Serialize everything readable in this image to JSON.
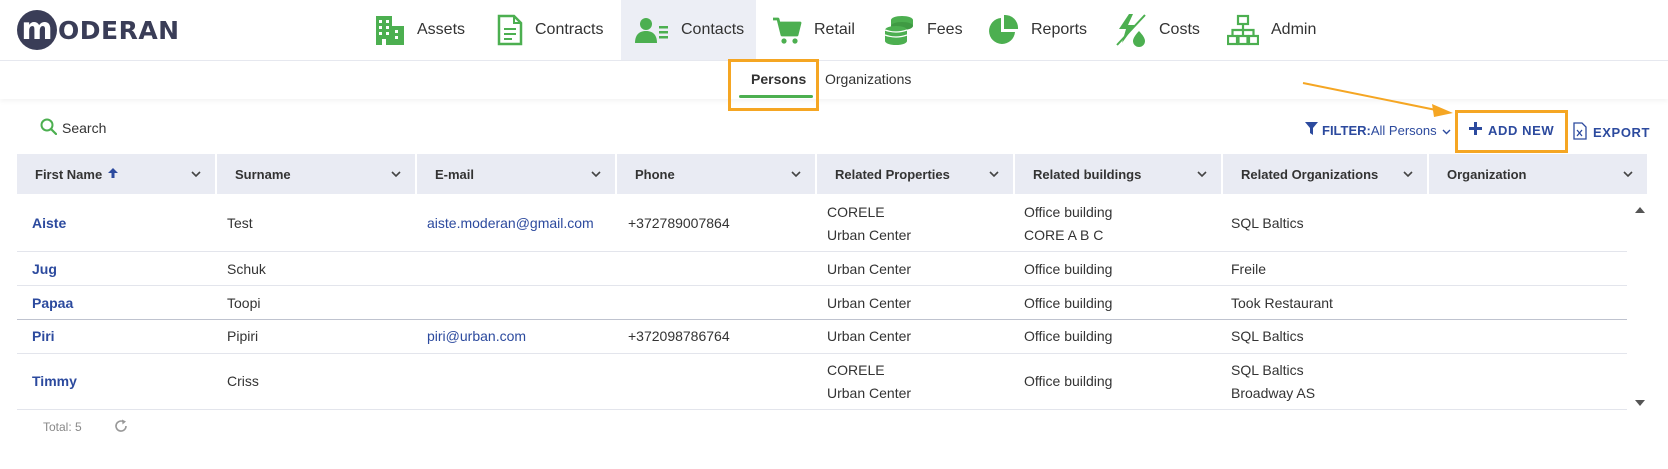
{
  "app": {
    "logo_letter": "m",
    "logo_text": "ODERAN"
  },
  "nav": [
    {
      "label": "Assets",
      "icon": "buildings-icon"
    },
    {
      "label": "Contracts",
      "icon": "document-icon"
    },
    {
      "label": "Contacts",
      "icon": "contacts-icon",
      "active": true
    },
    {
      "label": "Retail",
      "icon": "cart-icon"
    },
    {
      "label": "Fees",
      "icon": "coins-icon"
    },
    {
      "label": "Reports",
      "icon": "pie-chart-icon"
    },
    {
      "label": "Costs",
      "icon": "energy-icon"
    },
    {
      "label": "Admin",
      "icon": "org-chart-icon"
    }
  ],
  "subtabs": {
    "persons": "Persons",
    "organizations": "Organizations"
  },
  "toolbar": {
    "search": "Search",
    "filter_label": "FILTER:",
    "filter_value": "All Persons",
    "add_new": "ADD NEW",
    "export": "EXPORT"
  },
  "table": {
    "columns": [
      "First Name",
      "Surname",
      "E-mail",
      "Phone",
      "Related Properties",
      "Related buildings",
      "Related Organizations",
      "Organization"
    ],
    "sort_column": "First Name",
    "rows": [
      {
        "first": "Aiste",
        "surname": "Test",
        "email": "aiste.moderan@gmail.com",
        "phone": "+372789007864",
        "props1": "CORELE",
        "props2": "Urban Center",
        "bld1": "Office building",
        "bld2": "CORE A B C",
        "org1": "SQL Baltics",
        "org2": "",
        "organization": ""
      },
      {
        "first": "Jug",
        "surname": "Schuk",
        "email": "",
        "phone": "",
        "props1": "Urban Center",
        "props2": "",
        "bld1": "Office building",
        "bld2": "",
        "org1": "Freile",
        "org2": "",
        "organization": ""
      },
      {
        "first": "Papaa",
        "surname": "Toopi",
        "email": "",
        "phone": "",
        "props1": "Urban Center",
        "props2": "",
        "bld1": "Office building",
        "bld2": "",
        "org1": "Took Restaurant",
        "org2": "",
        "organization": ""
      },
      {
        "first": "Piri",
        "surname": "Pipiri",
        "email": "piri@urban.com",
        "phone": "+372098786764",
        "props1": "Urban Center",
        "props2": "",
        "bld1": "Office building",
        "bld2": "",
        "org1": "SQL Baltics",
        "org2": "",
        "organization": ""
      },
      {
        "first": "Timmy",
        "surname": "Criss",
        "email": "",
        "phone": "",
        "props1": "CORELE",
        "props2": "Urban Center",
        "bld1": "Office building",
        "bld2": "",
        "org1": "SQL Baltics",
        "org2": "Broadway AS",
        "organization": ""
      }
    ]
  },
  "footer": {
    "total": "Total: 5"
  },
  "colors": {
    "accent_green": "#4caf50",
    "link_blue": "#2c4a9e",
    "highlight": "#f5a623",
    "logo": "#3a3d57"
  }
}
